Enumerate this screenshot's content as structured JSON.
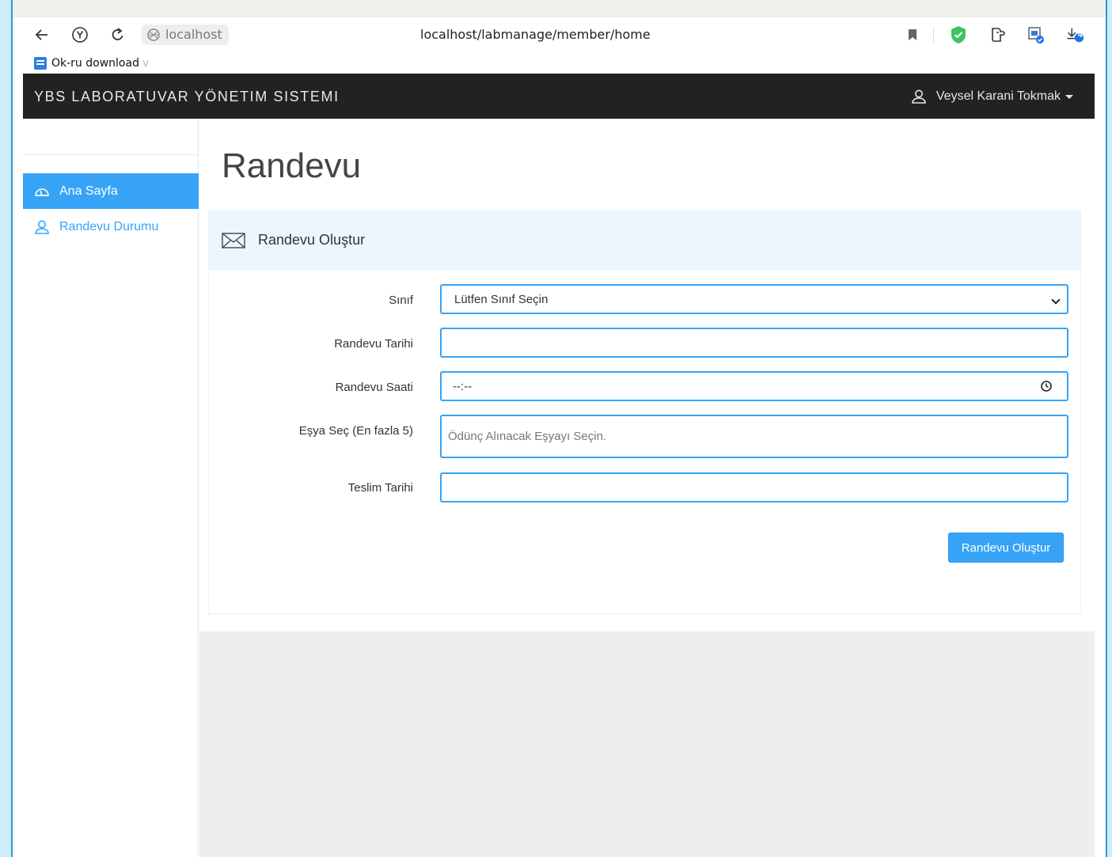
{
  "browser": {
    "site_chip": "localhost",
    "url": "localhost/labmanage/member/home",
    "bookmark_label": "Ok-ru download",
    "bookmark_fade": "v",
    "download_badge": "4"
  },
  "navbar": {
    "brand": "YBS LABORATUVAR YÖNETIM SISTEMI",
    "user_name": "Veysel Karani Tokmak"
  },
  "sidebar": {
    "items": [
      {
        "label": "Ana Sayfa",
        "icon": "dashboard-icon",
        "active": true
      },
      {
        "label": "Randevu Durumu",
        "icon": "user-icon",
        "active": false
      }
    ]
  },
  "main": {
    "title": "Randevu",
    "panel_heading": "Randevu Oluştur",
    "form": {
      "class_label": "Sınıf",
      "class_value": "Lütfen Sınıf Seçin",
      "date_label": "Randevu Tarihi",
      "date_value": "",
      "time_label": "Randevu Saati",
      "time_value": "--:--",
      "items_label": "Eşya Seç (En fazla 5)",
      "items_placeholder": "Ödünç Alınacak Eşyayı Seçin.",
      "return_label": "Teslim Tarihi",
      "return_value": "",
      "submit_label": "Randevu Oluştur"
    }
  },
  "colors": {
    "accent": "#36a3f7",
    "navbar": "#222222",
    "panel_heading_bg": "#eef6fd"
  }
}
